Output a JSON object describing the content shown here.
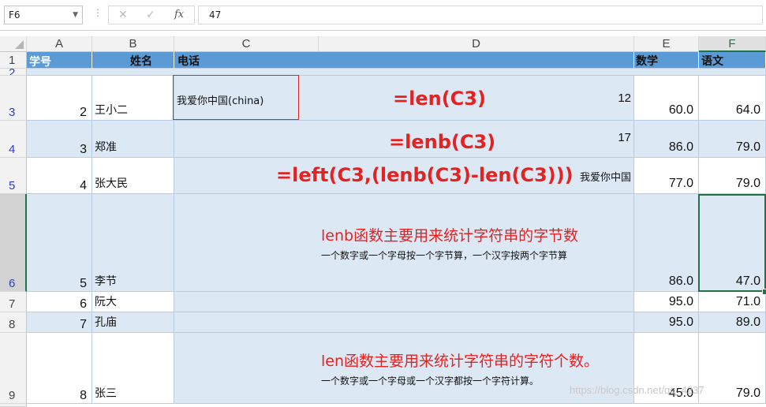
{
  "formula_bar": {
    "name_box": "F6",
    "cancel_icon": "✕",
    "enter_icon": "✓",
    "fx_icon": "fx",
    "value": "47"
  },
  "columns": [
    "A",
    "B",
    "C",
    "D",
    "E",
    "F"
  ],
  "row_numbers": [
    "1",
    "2",
    "3",
    "4",
    "5",
    "6",
    "7",
    "8",
    "9"
  ],
  "header_row": {
    "a": "学号",
    "b": "姓名",
    "c": "电话",
    "e": "数学",
    "f": "语文"
  },
  "rows": [
    {
      "id": "2",
      "name": "王小二",
      "phone": "我爱你中国(china)",
      "d": "12",
      "math": "60.0",
      "chinese": "64.0"
    },
    {
      "id": "3",
      "name": "郑准",
      "phone": "",
      "d": "17",
      "math": "86.0",
      "chinese": "79.0"
    },
    {
      "id": "4",
      "name": "张大民",
      "phone": "",
      "d": "我爱你中国",
      "math": "77.0",
      "chinese": "79.0"
    },
    {
      "id": "5",
      "name": "李节",
      "phone": "",
      "d": "",
      "math": "86.0",
      "chinese": "47.0"
    },
    {
      "id": "6",
      "name": "阮大",
      "phone": "",
      "d": "",
      "math": "95.0",
      "chinese": "71.0"
    },
    {
      "id": "7",
      "name": "孔庙",
      "phone": "",
      "d": "",
      "math": "95.0",
      "chinese": "89.0"
    },
    {
      "id": "8",
      "name": "张三",
      "phone": "",
      "d": "",
      "math": "45.0",
      "chinese": "79.0"
    }
  ],
  "annotations": {
    "len_formula": "=len(C3)",
    "lenb_formula": "=lenb(C3)",
    "left_formula": "=left(C3,(lenb(C3)-len(C3)))",
    "lenb_note_title": "lenb函数主要用来统计字符串的字节数",
    "lenb_note_body": "一个数字或一个字母按一个字节算，一个汉字按两个字节算",
    "len_note_title": "len函数主要用来统计字符串的字符个数。",
    "len_note_body": "一个数字或一个字母或一个汉字都按一个字符计算。"
  },
  "watermark": "https://blog.csdn.net/qq_4237"
}
